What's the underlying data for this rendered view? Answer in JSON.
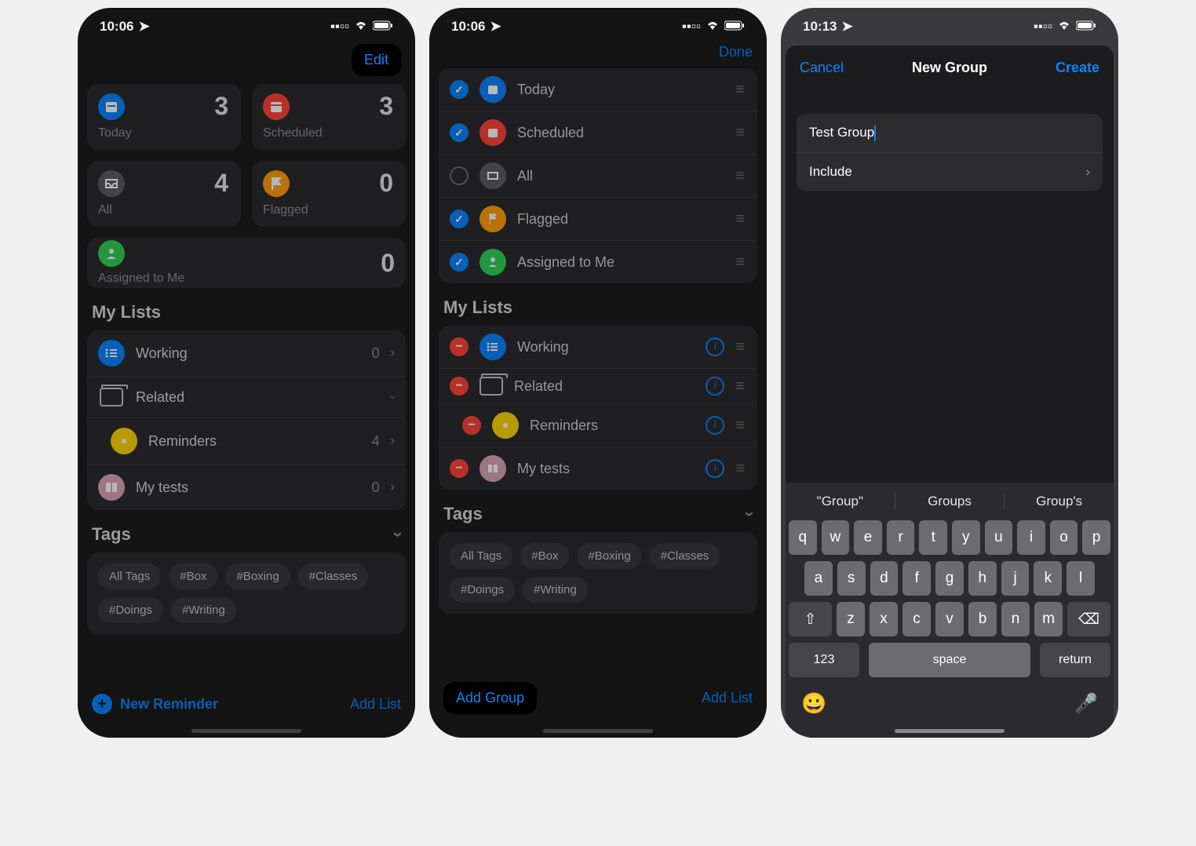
{
  "screen1": {
    "time": "10:06",
    "edit": "Edit",
    "cards": {
      "today": {
        "label": "Today",
        "count": "3"
      },
      "scheduled": {
        "label": "Scheduled",
        "count": "3"
      },
      "all": {
        "label": "All",
        "count": "4"
      },
      "flagged": {
        "label": "Flagged",
        "count": "0"
      },
      "assigned": {
        "label": "Assigned to Me",
        "count": "0"
      }
    },
    "mylists_header": "My Lists",
    "lists": {
      "working": {
        "name": "Working",
        "count": "0"
      },
      "related": {
        "name": "Related"
      },
      "reminders": {
        "name": "Reminders",
        "count": "4"
      },
      "mytests": {
        "name": "My tests",
        "count": "0"
      }
    },
    "tags_header": "Tags",
    "tags": [
      "All Tags",
      "#Box",
      "#Boxing",
      "#Classes",
      "#Doings",
      "#Writing"
    ],
    "new_reminder": "New Reminder",
    "add_list": "Add List"
  },
  "screen2": {
    "time": "10:06",
    "done": "Done",
    "smart": {
      "today": {
        "name": "Today",
        "checked": true
      },
      "scheduled": {
        "name": "Scheduled",
        "checked": true
      },
      "all": {
        "name": "All",
        "checked": false
      },
      "flagged": {
        "name": "Flagged",
        "checked": true
      },
      "assigned": {
        "name": "Assigned to Me",
        "checked": true
      }
    },
    "mylists_header": "My Lists",
    "lists": {
      "working": {
        "name": "Working"
      },
      "related": {
        "name": "Related"
      },
      "reminders": {
        "name": "Reminders"
      },
      "mytests": {
        "name": "My tests"
      }
    },
    "tags_header": "Tags",
    "tags": [
      "All Tags",
      "#Box",
      "#Boxing",
      "#Classes",
      "#Doings",
      "#Writing"
    ],
    "add_group": "Add Group",
    "add_list": "Add List"
  },
  "screen3": {
    "time": "10:13",
    "modal": {
      "cancel": "Cancel",
      "title": "New Group",
      "create": "Create",
      "name_value": "Test Group",
      "include_label": "Include"
    },
    "suggestions": [
      "\"Group\"",
      "Groups",
      "Group's"
    ],
    "kbd_row1": [
      "q",
      "w",
      "e",
      "r",
      "t",
      "y",
      "u",
      "i",
      "o",
      "p"
    ],
    "kbd_row2": [
      "a",
      "s",
      "d",
      "f",
      "g",
      "h",
      "j",
      "k",
      "l"
    ],
    "kbd_row3": [
      "z",
      "x",
      "c",
      "v",
      "b",
      "n",
      "m"
    ],
    "key_123": "123",
    "key_space": "space",
    "key_return": "return"
  }
}
